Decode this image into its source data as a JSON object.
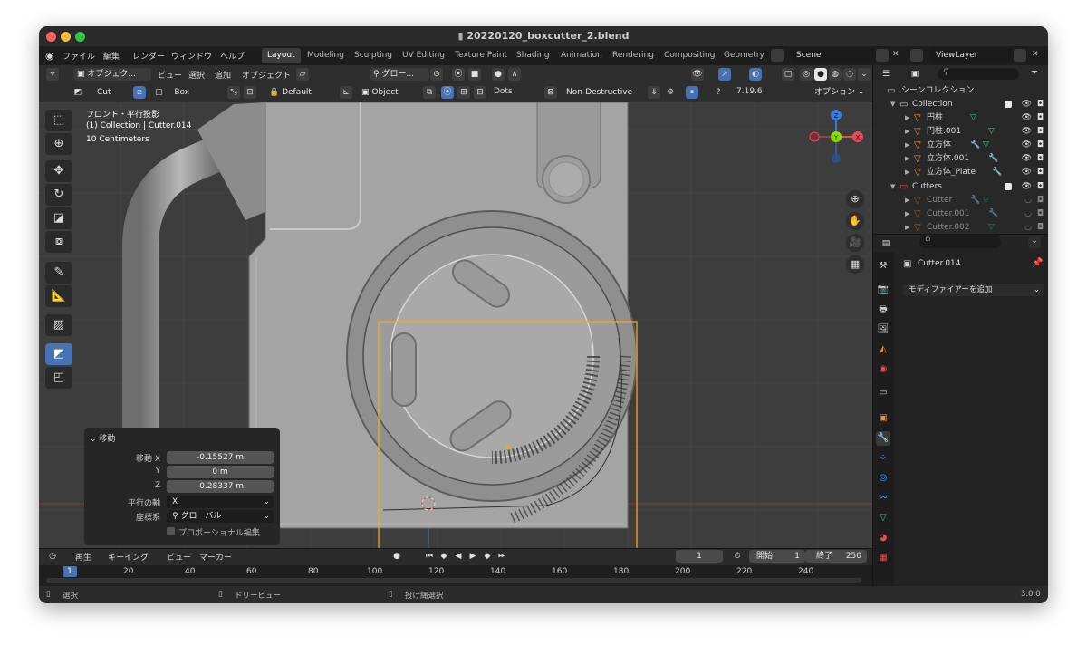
{
  "window": {
    "title": "20220120_boxcutter_2.blend"
  },
  "menubar": {
    "menus": [
      "ファイル",
      "編集",
      "レンダー",
      "ウィンドウ",
      "ヘルプ"
    ],
    "workspaces": [
      "Layout",
      "Modeling",
      "Sculpting",
      "UV Editing",
      "Texture Paint",
      "Shading",
      "Animation",
      "Rendering",
      "Compositing",
      "Geometry"
    ],
    "active_workspace": "Layout",
    "scene": "Scene",
    "viewlayer": "ViewLayer"
  },
  "header1": {
    "mode": "オブジェク...",
    "menus": [
      "ビュー",
      "選択",
      "追加",
      "オブジェクト"
    ],
    "transform_orientation": "グロー..."
  },
  "header2": {
    "tool_mode": "Cut",
    "shape": "Box",
    "behavior": "Default",
    "object": "Object",
    "dots": "Dots",
    "non_destructive": "Non-Destructive",
    "version": "7.19.6",
    "options": "オプション"
  },
  "viewport": {
    "view_name": "フロント・平行投影",
    "collection_info": "(1) Collection | Cutter.014",
    "scale": "10 Centimeters",
    "gizmo": {
      "z": "Z",
      "y": "Y",
      "x": "X"
    }
  },
  "redo_panel": {
    "title": "移動",
    "move_x_label": "移動 X",
    "move_x": "-0.15527 m",
    "y_label": "Y",
    "y": "0 m",
    "z_label": "Z",
    "z": "-0.28337 m",
    "axis_label": "平行の軸",
    "axis": "X",
    "orientation_label": "座標系",
    "orientation": "グローバル",
    "proportional": "プロポーショナル編集"
  },
  "timeline": {
    "menus": [
      "再生",
      "キーイング",
      "ビュー",
      "マーカー"
    ],
    "current_frame": "1",
    "start_label": "開始",
    "start": "1",
    "end_label": "終了",
    "end": "250",
    "ticks": [
      "20",
      "40",
      "60",
      "80",
      "100",
      "120",
      "140",
      "160",
      "180",
      "200",
      "220",
      "240"
    ],
    "playhead": "1"
  },
  "statusbar": {
    "select": "選択",
    "dolly": "ドリービュー",
    "lasso": "投げ縄選択",
    "version": "3.0.0"
  },
  "outliner": {
    "scene_collection": "シーンコレクション",
    "collection": "Collection",
    "items": [
      "円柱",
      "円柱.001",
      "立方体",
      "立方体.001",
      "立方体_Plate"
    ],
    "cutters": "Cutters",
    "cutter_items": [
      "Cutter",
      "Cutter.001",
      "Cutter.002"
    ]
  },
  "properties": {
    "object_name": "Cutter.014",
    "add_modifier": "モディファイアーを追加"
  },
  "colors": {
    "accent": "#4772b3",
    "selection": "#f5a623",
    "axis_x": "#e24d58",
    "axis_y": "#8bdc00",
    "axis_z": "#3c79d8"
  }
}
